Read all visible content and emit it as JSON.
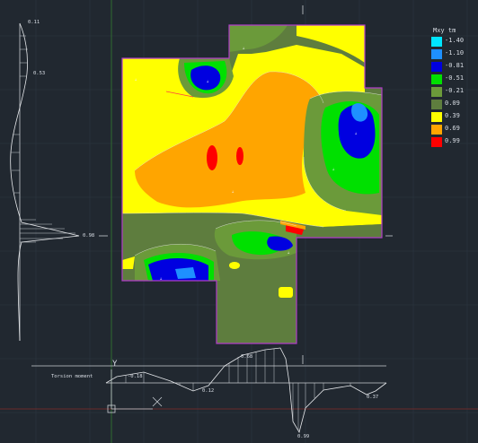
{
  "legend": {
    "title": "Mxy  tm",
    "items": [
      {
        "value": "-1.40",
        "color": "#00e5ff"
      },
      {
        "value": "-1.10",
        "color": "#1e90ff"
      },
      {
        "value": "-0.81",
        "color": "#0000e0"
      },
      {
        "value": "-0.51",
        "color": "#00e000"
      },
      {
        "value": "-0.21",
        "color": "#6b9a3a"
      },
      {
        "value": "0.09",
        "color": "#5e7d3e"
      },
      {
        "value": "0.39",
        "color": "#ffff00"
      },
      {
        "value": "0.69",
        "color": "#ffa500"
      },
      {
        "value": "0.99",
        "color": "#ff0000"
      }
    ]
  },
  "left_profile": {
    "top_value": "0.11",
    "mid_value": "0.53",
    "peak_value": "0.98"
  },
  "bottom_profile": {
    "title": "Torsion moment",
    "label_left": "-0.18",
    "label_dip": "0.12",
    "label_peak": "0.68",
    "label_min": "0.99",
    "label_right": "0.37"
  },
  "ucs_icon": {
    "label": "Y"
  },
  "colors": {
    "background": "#212830",
    "slab_outline": "#b03cc8",
    "grid": "#3a4450",
    "axis_green": "#2f6b2f",
    "axis_red": "#6b2a2a"
  }
}
